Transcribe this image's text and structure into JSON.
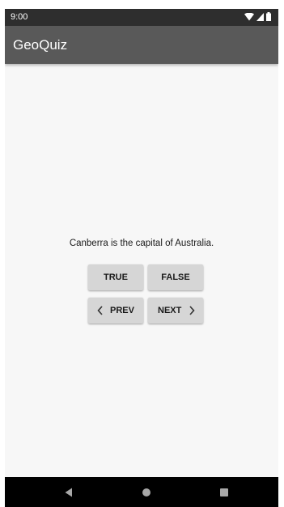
{
  "status_bar": {
    "time": "9:00",
    "icons": [
      "wifi-icon",
      "cellular-signal-icon",
      "battery-icon"
    ]
  },
  "app_bar": {
    "title": "GeoQuiz"
  },
  "quiz": {
    "question": "Canberra is the capital of Australia.",
    "true_label": "TRUE",
    "false_label": "FALSE",
    "prev_label": "PREV",
    "next_label": "NEXT"
  },
  "nav_bar": {
    "icons": [
      "back-icon",
      "home-icon",
      "recents-icon"
    ]
  },
  "colors": {
    "status_bar": "#2e2e2e",
    "app_bar": "#595959",
    "background": "#f7f7f7",
    "button": "#d6d6d6",
    "nav_bar": "#000000"
  }
}
